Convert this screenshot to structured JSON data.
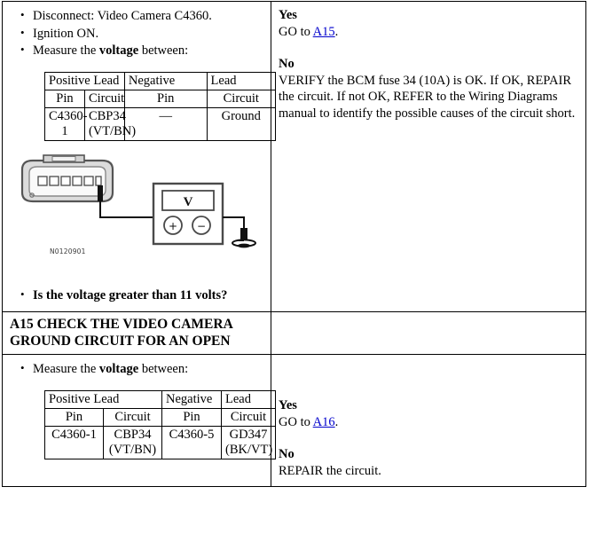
{
  "document": {
    "type": "diagnostic-procedure-page"
  },
  "step_a14": {
    "instructions": [
      {
        "text_before": "Disconnect: Video Camera C4360.",
        "bold": "",
        "text_after": ""
      },
      {
        "text_before": "Ignition ON.",
        "bold": "",
        "text_after": ""
      },
      {
        "text_before": "Measure the ",
        "bold": "voltage",
        "text_after": " between:"
      }
    ],
    "lead_table": {
      "group_headers": {
        "positive": "Positive Lead",
        "negative": "Negative",
        "negative_second": "Lead"
      },
      "column_headers": {
        "pos_pin": "Pin",
        "pos_circuit": "Circuit",
        "neg_pin": "Pin",
        "neg_circuit": "Circuit"
      },
      "row": {
        "pos_pin": "C4360-1",
        "pos_circuit_line1": "CBP34",
        "pos_circuit_line2": "(VT/BN)",
        "neg_pin": "—",
        "neg_circuit": "Ground"
      }
    },
    "figure": {
      "code": "N0120901",
      "meter_label": "V",
      "positive_terminal": "+",
      "negative_terminal": "−"
    },
    "question": "Is the voltage greater than 11 volts?",
    "answers": {
      "yes_label": "Yes",
      "yes_text_before": "GO to ",
      "yes_link": "A15",
      "yes_text_after": ".",
      "no_label": "No",
      "no_text": "VERIFY the BCM fuse 34 (10A) is OK. If OK, REPAIR the circuit. If not OK, REFER to the Wiring Diagrams manual to identify the possible causes of the circuit short."
    }
  },
  "step_a15": {
    "heading": "A15 CHECK THE VIDEO CAMERA GROUND CIRCUIT FOR AN OPEN",
    "instructions": [
      {
        "text_before": "Measure the ",
        "bold": "voltage",
        "text_after": " between:"
      }
    ],
    "lead_table": {
      "group_headers": {
        "positive": "Positive Lead",
        "negative": "Negative",
        "negative_second": "Lead"
      },
      "column_headers": {
        "pos_pin": "Pin",
        "pos_circuit": "Circuit",
        "neg_pin": "Pin",
        "neg_circuit": "Circuit"
      },
      "row": {
        "pos_pin": "C4360-1",
        "pos_circuit_line1": "CBP34",
        "pos_circuit_line2": "(VT/BN)",
        "neg_pin": "C4360-5",
        "neg_circuit_line1": "GD347",
        "neg_circuit_line2": "(BK/VT)"
      }
    },
    "answers": {
      "yes_label": "Yes",
      "yes_text_before": "GO to ",
      "yes_link": "A16",
      "yes_text_after": ".",
      "no_label": "No",
      "no_text": "REPAIR the circuit."
    }
  },
  "colors": {
    "link": "#0000cc",
    "text": "#000000",
    "border": "#000000"
  }
}
